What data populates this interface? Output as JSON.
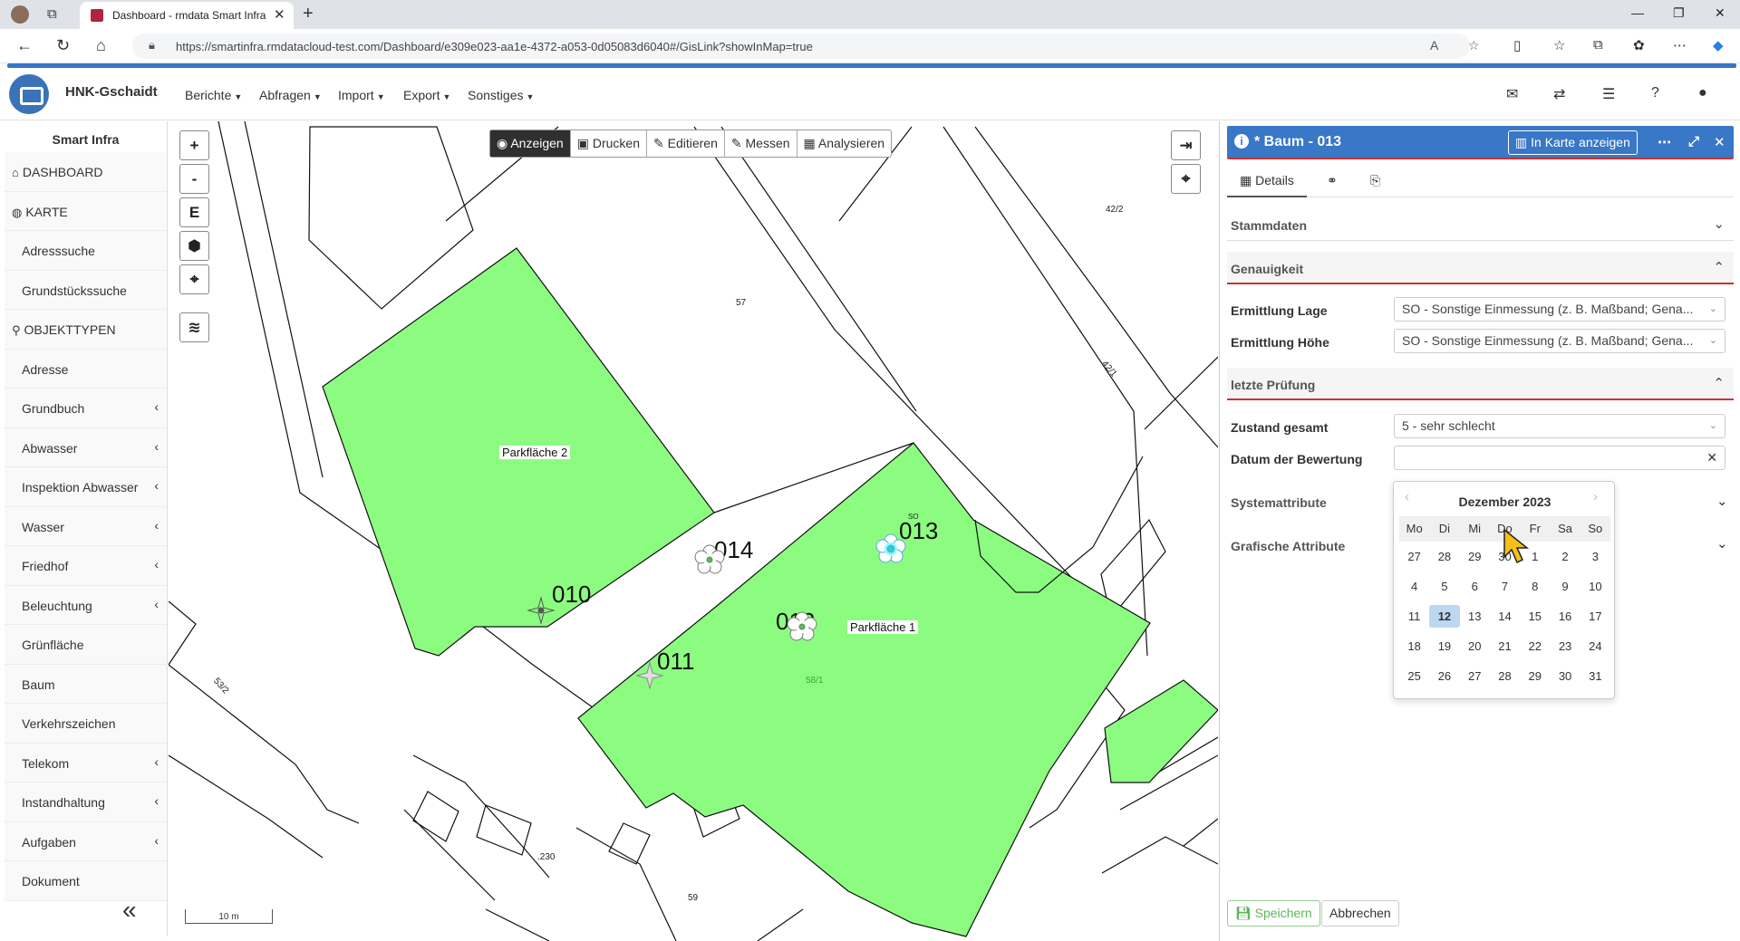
{
  "browser": {
    "tab_title": "Dashboard - rmdata Smart Infra",
    "url": "https://smartinfra.rmdatacloud-test.com/Dashboard/e309e023-aa1e-4372-a053-0d05083d6040#/GisLink?showInMap=true"
  },
  "app": {
    "title": "HNK-Gschaidt",
    "menus": [
      "Berichte",
      "Abfragen",
      "Import",
      "Export",
      "Sonstiges"
    ]
  },
  "sidebar": {
    "title": "Smart Infra",
    "items": [
      {
        "label": "DASHBOARD",
        "icon": "home-icon",
        "head": true,
        "chev": false
      },
      {
        "label": "KARTE",
        "icon": "globe-icon",
        "head": true,
        "chev": false
      },
      {
        "label": "Adresssuche",
        "head": false,
        "chev": false
      },
      {
        "label": "Grundstückssuche",
        "head": false,
        "chev": false
      },
      {
        "label": "OBJEKTTYPEN",
        "icon": "search-icon",
        "head": true,
        "chev": false
      },
      {
        "label": "Adresse",
        "head": false,
        "chev": false
      },
      {
        "label": "Grundbuch",
        "head": false,
        "chev": true
      },
      {
        "label": "Abwasser",
        "head": false,
        "chev": true
      },
      {
        "label": "Inspektion Abwasser",
        "head": false,
        "chev": true
      },
      {
        "label": "Wasser",
        "head": false,
        "chev": true
      },
      {
        "label": "Friedhof",
        "head": false,
        "chev": true
      },
      {
        "label": "Beleuchtung",
        "head": false,
        "chev": true
      },
      {
        "label": "Grünfläche",
        "head": false,
        "chev": false
      },
      {
        "label": "Baum",
        "head": false,
        "chev": false
      },
      {
        "label": "Verkehrszeichen",
        "head": false,
        "chev": false
      },
      {
        "label": "Telekom",
        "head": false,
        "chev": true
      },
      {
        "label": "Instandhaltung",
        "head": false,
        "chev": true
      },
      {
        "label": "Aufgaben",
        "head": false,
        "chev": true
      },
      {
        "label": "Dokument",
        "head": false,
        "chev": false
      }
    ]
  },
  "map": {
    "zoom_controls": [
      "+",
      "-",
      "E"
    ],
    "tools": [
      "Anzeigen",
      "Drucken",
      "Editieren",
      "Messen",
      "Analysieren"
    ],
    "active_tool": "Anzeigen",
    "area_labels": [
      "Parkfläche 2",
      "Parkfläche 1"
    ],
    "object_labels": [
      "010",
      "011",
      "012",
      "013",
      "014"
    ],
    "parcel_labels": [
      "57",
      "42/2",
      "42/1",
      "53/2",
      ".230",
      "59",
      "58/1",
      "SO"
    ],
    "scale": "10 m",
    "fill_color": "#8cfc80"
  },
  "panel": {
    "title": "* Baum - 013",
    "show_in_map": "In Karte anzeigen",
    "tab_details": "Details",
    "sections": {
      "stammdaten": "Stammdaten",
      "genauigkeit": "Genauigkeit",
      "letzte_pruefung": "letzte Prüfung",
      "systemattribute": "Systemattribute",
      "grafische": "Grafische Attribute"
    },
    "fields": {
      "ermittlung_lage_label": "Ermittlung Lage",
      "ermittlung_lage_value": "SO - Sonstige Einmessung (z. B. Maßband; Gena...",
      "ermittlung_hoehe_label": "Ermittlung Höhe",
      "ermittlung_hoehe_value": "SO - Sonstige Einmessung (z. B. Maßband; Gena...",
      "zustand_label": "Zustand gesamt",
      "zustand_value": "5 - sehr schlecht",
      "datum_label": "Datum der Bewertung",
      "datum_value": ""
    },
    "calendar": {
      "month": "Dezember 2023",
      "weekdays": [
        "Mo",
        "Di",
        "Mi",
        "Do",
        "Fr",
        "Sa",
        "So"
      ],
      "weeks": [
        [
          "27",
          "28",
          "29",
          "30",
          "1",
          "2",
          "3"
        ],
        [
          "4",
          "5",
          "6",
          "7",
          "8",
          "9",
          "10"
        ],
        [
          "11",
          "12",
          "13",
          "14",
          "15",
          "16",
          "17"
        ],
        [
          "18",
          "19",
          "20",
          "21",
          "22",
          "23",
          "24"
        ],
        [
          "25",
          "26",
          "27",
          "28",
          "29",
          "30",
          "31"
        ]
      ],
      "selected": "12"
    },
    "save": "Speichern",
    "cancel": "Abbrechen"
  },
  "colors": {
    "primary": "#3977c7",
    "accent_red": "#d03030",
    "save_green": "#5cb85c"
  }
}
